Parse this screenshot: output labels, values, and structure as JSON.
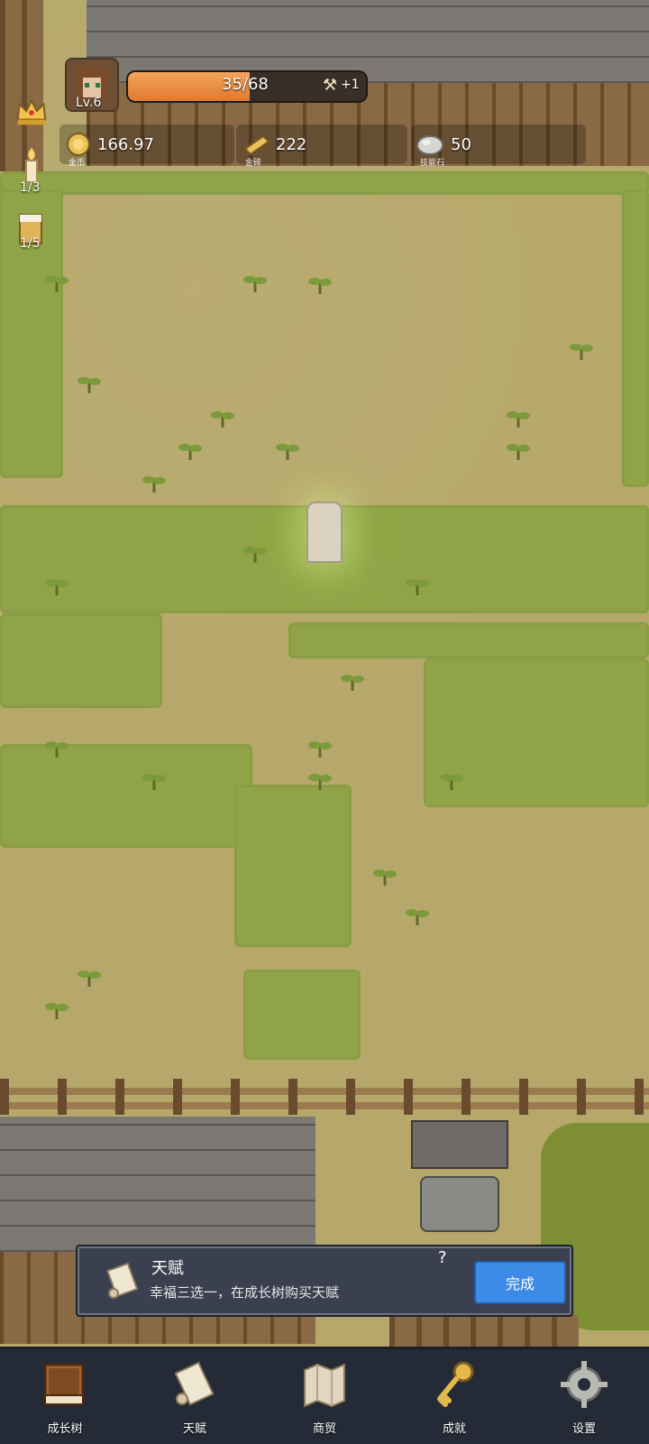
{
  "hud": {
    "level": "Lv.6",
    "xp": {
      "text": "35/68",
      "fill_ratio": 0.51,
      "bonus": "+1"
    },
    "resources": [
      {
        "value": "166.97",
        "label": "金币",
        "icon": "gold-coin-icon"
      },
      {
        "value": "222",
        "label": "金砖",
        "icon": "gold-bar-icon"
      },
      {
        "value": "50",
        "label": "技能石",
        "icon": "skill-stone-icon"
      }
    ],
    "left_buttons": [
      {
        "icon": "crown-icon",
        "count": ""
      },
      {
        "icon": "candle-icon",
        "count": "1/3"
      },
      {
        "icon": "beer-mug-icon",
        "count": "1/5"
      }
    ]
  },
  "task": {
    "title": "天赋",
    "description": "幸福三选一，在成长树购买天赋",
    "done_label": "完成",
    "help_icon": "question-mark-icon",
    "icon": "scroll-icon"
  },
  "nav": {
    "items": [
      {
        "label": "成长树",
        "icon": "book-icon"
      },
      {
        "label": "天赋",
        "icon": "scroll-icon"
      },
      {
        "label": "商贸",
        "icon": "map-icon"
      },
      {
        "label": "成就",
        "icon": "key-icon"
      },
      {
        "label": "设置",
        "icon": "gear-icon"
      }
    ]
  },
  "colors": {
    "accent_button": "#3d8be6",
    "xp_fill": "#e1792f",
    "grass": "#90a447",
    "ground": "#b6a86a",
    "panel": "#3a404f",
    "nav": "#242a36"
  }
}
